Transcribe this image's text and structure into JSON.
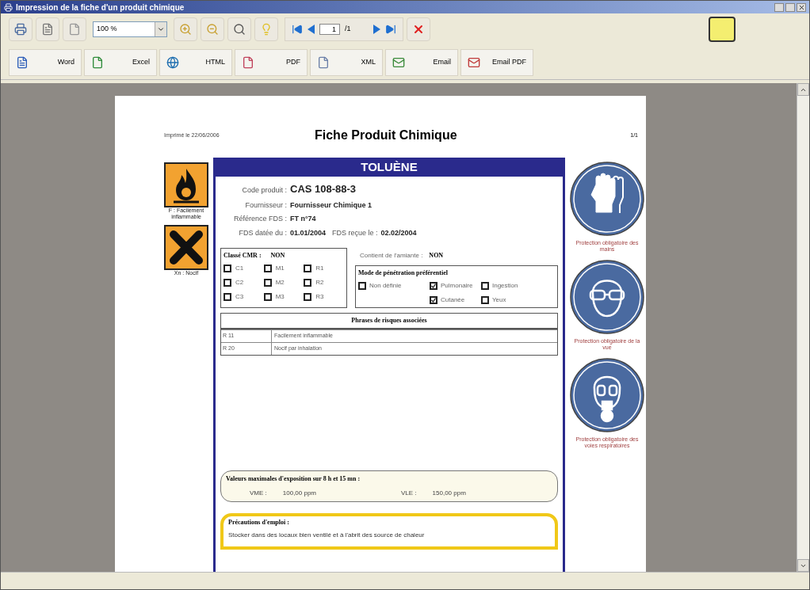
{
  "window": {
    "title": "Impression de la fiche d'un produit chimique"
  },
  "toolbar": {
    "zoom": "100 %",
    "page_input": "1",
    "page_count": "/1"
  },
  "export_buttons": [
    {
      "kind": "word",
      "label": "Word"
    },
    {
      "kind": "excel",
      "label": "Excel"
    },
    {
      "kind": "html",
      "label": "HTML"
    },
    {
      "kind": "pdf",
      "label": "PDF"
    },
    {
      "kind": "xml",
      "label": "XML"
    },
    {
      "kind": "email",
      "label": "Email"
    },
    {
      "kind": "emailpdf",
      "label": "Email PDF"
    }
  ],
  "document": {
    "printed_date": "Imprimé le 22/06/2006",
    "title": "Fiche Produit Chimique",
    "page_number": "1/1",
    "product_name": "TOLUÈNE",
    "code": {
      "label": "Code produit :",
      "value": "CAS 108-88-3"
    },
    "supplier": {
      "label": "Fournisseur :",
      "value": "Fournisseur Chimique 1"
    },
    "reference": {
      "label": "Référence FDS :",
      "value": "FT n°74"
    },
    "fds_dated": {
      "label": "FDS datée du :",
      "value": "01.01/2004"
    },
    "fds_received": {
      "label": "FDS reçue le :",
      "value": "02.02/2004"
    },
    "cmr": {
      "label": "Classé CMR :",
      "value": "NON",
      "checkboxes": [
        {
          "label": "C1",
          "checked": false
        },
        {
          "label": "M1",
          "checked": false
        },
        {
          "label": "R1",
          "checked": false
        },
        {
          "label": "C2",
          "checked": false
        },
        {
          "label": "M2",
          "checked": false
        },
        {
          "label": "R2",
          "checked": false
        },
        {
          "label": "C3",
          "checked": false
        },
        {
          "label": "M3",
          "checked": false
        },
        {
          "label": "R3",
          "checked": false
        }
      ]
    },
    "asbestos": {
      "label": "Contient de l'amiante :",
      "value": "NON"
    },
    "penetration": {
      "title": "Mode de pénétration préférentiel",
      "options": [
        {
          "label": "Non définie",
          "checked": false
        },
        {
          "label": "Pulmonaire",
          "checked": true
        },
        {
          "label": "Ingestion",
          "checked": false
        },
        {
          "label": "Cutanée",
          "checked": true
        },
        {
          "label": "Yeux",
          "checked": false
        }
      ]
    },
    "risk_phrases": {
      "title": "Phrases de risques associées",
      "rows": [
        {
          "code": "R 11",
          "text": "Facilement inflammable"
        },
        {
          "code": "R 20",
          "text": "Nocif par inhalation"
        }
      ]
    },
    "exposure": {
      "title": "Valeurs maximales d'exposition sur 8 h et 15 mn :",
      "items": [
        {
          "label": "VME :",
          "value": "100,00 ppm"
        },
        {
          "label": "VLE :",
          "value": "150,00 ppm"
        }
      ]
    },
    "precautions": {
      "title": "Précautions d'emploi :",
      "text": "Stocker dans des locaux bien ventilé et à l'abrit des source de chaleur"
    },
    "hazard_symbols": [
      {
        "kind": "flame",
        "caption": "F : Facilement inflammable"
      },
      {
        "kind": "cross",
        "caption": "Xn : Nocif"
      }
    ],
    "ppe": [
      {
        "kind": "gloves",
        "caption": "Protection obligatoire des mains"
      },
      {
        "kind": "goggles",
        "caption": "Protection obligatoire de la vue"
      },
      {
        "kind": "mask",
        "caption": "Protection obligatoire des voies respiratoires"
      }
    ]
  }
}
